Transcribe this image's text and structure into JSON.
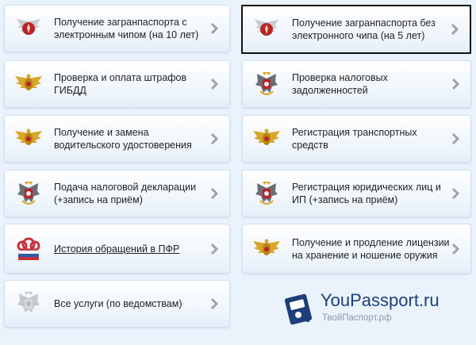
{
  "services": [
    {
      "label": "Получение загранпаспорта с электронным чипом (на 10 лет)",
      "icon": "mvd-emblem-icon"
    },
    {
      "label": "Получение загранпаспорта без электронного чипа (на 5 лет)",
      "icon": "mvd-emblem-icon",
      "selected": true
    },
    {
      "label": "Проверка и оплата штрафов ГИБДД",
      "icon": "gibdd-eagle-icon"
    },
    {
      "label": "Проверка налоговых задолженностей",
      "icon": "fns-eagle-icon"
    },
    {
      "label": "Получение и замена водительского удостоверения",
      "icon": "gibdd-eagle-icon"
    },
    {
      "label": "Регистрация транспортных средств",
      "icon": "gibdd-eagle-icon"
    },
    {
      "label": "Подача налоговой декларации (+запись на приём)",
      "icon": "fns-eagle-icon"
    },
    {
      "label": "Регистрация юридических лиц и ИП (+запись на приём)",
      "icon": "fns-eagle-icon"
    },
    {
      "label": "История обращений в ПФР",
      "icon": "pfr-logo-icon"
    },
    {
      "label": "Получение и продление лицензии на хранение и ношение оружия",
      "icon": "mvd-eagle-icon"
    },
    {
      "label": "Все услуги (по ведомствам)",
      "icon": "gray-eagle-icon"
    }
  ],
  "brand": {
    "name": "YouPassport.ru",
    "subtitle": "ТвойПаспорт.рф",
    "icon": "passport-logo-icon"
  },
  "colors": {
    "background": "#eaf3fb",
    "tile_border": "#d3e1ee",
    "chevron": "#9aa4ad",
    "brand_text": "#1d3f7a"
  }
}
